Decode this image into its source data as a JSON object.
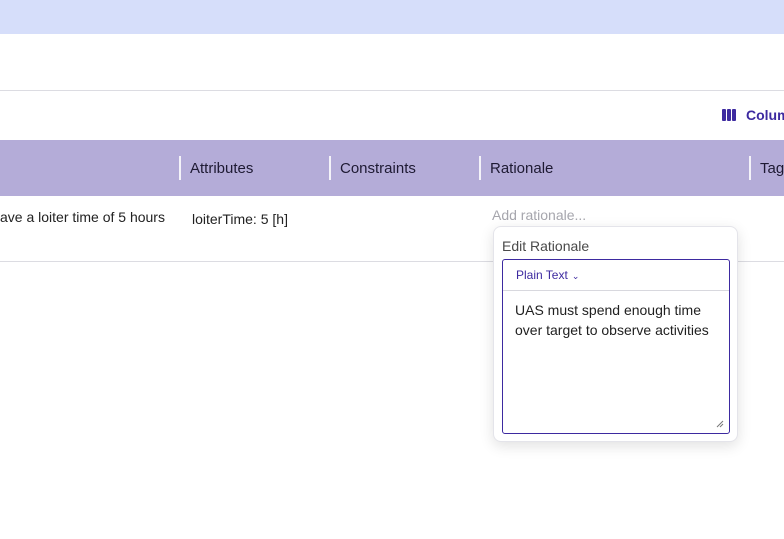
{
  "toolbar": {
    "columns_label": "Columns"
  },
  "table": {
    "headers": [
      "Attributes",
      "Constraints",
      "Rationale",
      "Tags"
    ],
    "row": {
      "description": "ave a loiter time of 5 hours",
      "attributes": "loiterTime: 5 [h]",
      "rationale_placeholder": "Add rationale..."
    }
  },
  "popover": {
    "title": "Edit Rationale",
    "format": "Plain Text",
    "text": "UAS must spend enough time over target to observe activities"
  },
  "colors": {
    "banner": "#d6defa",
    "header": "#b4acd8",
    "accent": "#3d2aa0"
  }
}
